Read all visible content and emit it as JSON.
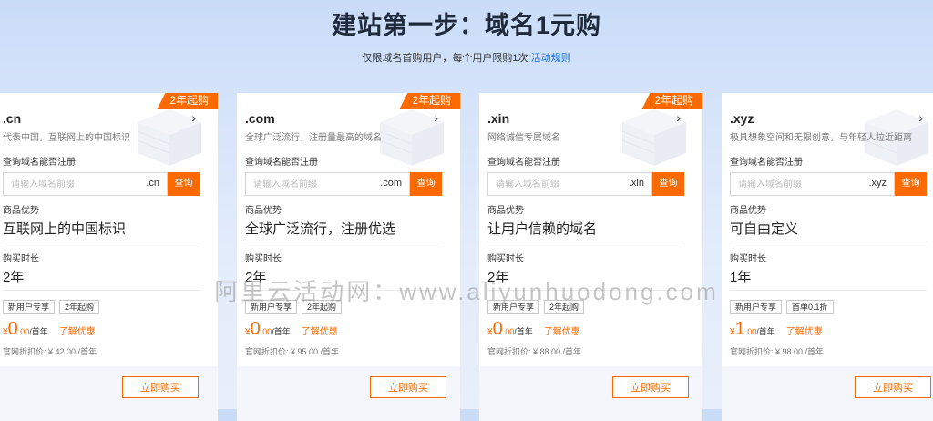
{
  "header": {
    "title": "建站第一步：域名1元购",
    "subtitle": "仅限域名首购用户，每个用户限购1次",
    "rule_link": "活动规则"
  },
  "colors": {
    "accent": "#ff6a00",
    "link": "#1a73e8"
  },
  "common": {
    "query_label": "查询域名能否注册",
    "placeholder": "请输入域名前缀",
    "query_button": "查询",
    "advantage_label": "商品优势",
    "duration_label": "购买时长",
    "promo_link": "了解优惠",
    "buy_button": "立即购买",
    "chevron": "›"
  },
  "cards": [
    {
      "badge": "2年起购",
      "tld": ".cn",
      "description": "代表中国，互联网上的中国标识",
      "suffix": ".cn",
      "advantage": "互联网上的中国标识",
      "duration": "2年",
      "tags": [
        "新用户专享",
        "2年起购"
      ],
      "price_currency": "¥",
      "price_int": "0",
      "price_dec": ".00",
      "price_unit": "/首年",
      "original_price": "官网折扣价: ¥ 42.00 /首年"
    },
    {
      "badge": "2年起购",
      "tld": ".com",
      "description": "全球广泛流行，注册量最高的域名",
      "suffix": ".com",
      "advantage": "全球广泛流行，注册优选",
      "duration": "2年",
      "tags": [
        "新用户专享",
        "2年起购"
      ],
      "price_currency": "¥",
      "price_int": "0",
      "price_dec": ".00",
      "price_unit": "/首年",
      "original_price": "官网折扣价: ¥ 95.00 /首年"
    },
    {
      "badge": "2年起购",
      "tld": ".xin",
      "description": "网络诚信专属域名",
      "suffix": ".xin",
      "advantage": "让用户信赖的域名",
      "duration": "2年",
      "tags": [
        "新用户专享",
        "2年起购"
      ],
      "price_currency": "¥",
      "price_int": "0",
      "price_dec": ".00",
      "price_unit": "/首年",
      "original_price": "官网折扣价: ¥ 88.00 /首年"
    },
    {
      "badge": "",
      "tld": ".xyz",
      "description": "极具想象空间和无限创意，与年轻人拉近距离",
      "suffix": ".xyz",
      "advantage": "可自由定义",
      "duration": "1年",
      "tags": [
        "新用户专享",
        "首单0.1折"
      ],
      "price_currency": "¥",
      "price_int": "1",
      "price_dec": ".00",
      "price_unit": "/首年",
      "original_price": "官网折扣价: ¥ 98.00 /首年"
    }
  ],
  "watermark": "阿里云活动网：www.aliyunhuodong.com"
}
